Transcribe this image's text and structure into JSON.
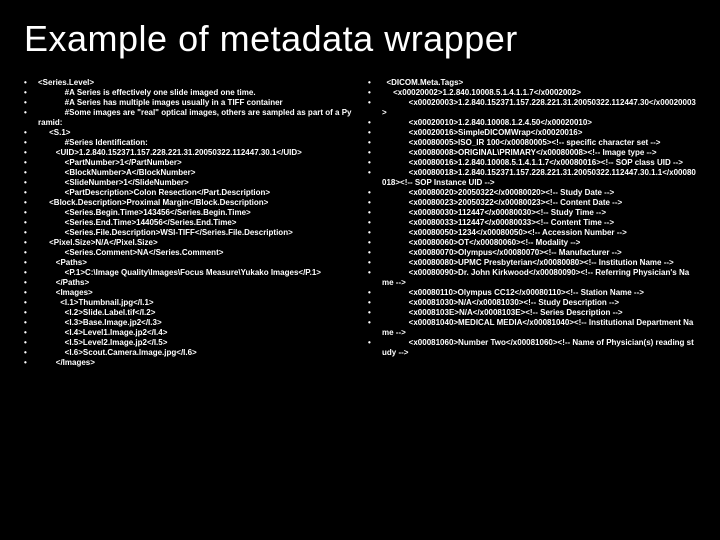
{
  "title": "Example of metadata wrapper",
  "left": [
    "<Series.Level>",
    "            #A Series is effectively one slide imaged one time.",
    "            #A Series has multiple images usually in a TIFF container",
    "            #Some images are \"real\" optical images, others are sampled as part of a Pyramid:",
    "     <S.1>",
    "            #Series Identification:",
    "        <UID>1.2.840.152371.157.228.221.31.20050322.112447.30.1</UID>",
    "            <PartNumber>1</PartNumber>",
    "            <BlockNumber>A</BlockNumber>",
    "            <SlideNumber>1</SlideNumber>",
    "            <PartDescription>Colon Resection</Part.Description>",
    "     <Block.Description>Proximal Margin</Block.Description>",
    "            <Series.Begin.Time>143456</Series.Begin.Time>",
    "            <Series.End.Time>144056</Series.End.Time>",
    "            <Series.File.Description>WSI-TIFF</Series.File.Description>",
    "     <Pixel.Size>N/A</Pixel.Size>",
    "            <Series.Comment>NA</Series.Comment>",
    "        <Paths>",
    "            <P.1>C:\\Image Quality\\Images\\Focus Measure\\Yukako Images</P.1>",
    "        </Paths>",
    "        <Images>",
    "          <I.1>Thumbnail.jpg</I.1>",
    "            <I.2>Slide.Label.tif</I.2>",
    "            <I.3>Base.Image.jp2</I.3>",
    "            <I.4>Level1.Image.jp2</I.4>",
    "            <I.5>Level2.Image.jp2</I.5>",
    "            <I.6>Scout.Camera.Image.jpg</I.6>",
    "        </Images>"
  ],
  "right": [
    "  <DICOM.Meta.Tags>",
    "     <x00020002>1.2.840.10008.5.1.4.1.1.7</x0002002>",
    "            <x00020003>1.2.840.152371.157.228.221.31.20050322.112447.30</x00020003>",
    "            <x00020010>1.2.840.10008.1.2.4.50</x00020010>",
    "            <x00020016>SimpleDICOMWrap</x00020016>",
    "            <x00080005>ISO_IR 100</x00080005><!-- specific character set -->",
    "            <x00080008>ORIGINAL\\PRIMARY</x00080008><!-- Image type -->",
    "            <x00080016>1.2.840.10008.5.1.4.1.1.7</x00080016><!-- SOP class UID -->",
    "            <x00080018>1.2.840.152371.157.228.221.31.20050322.112447.30.1.1</x00080018><!-- SOP Instance UID -->",
    "            <x00080020>20050322</x00080020><!-- Study Date -->",
    "            <x00080023>20050322</x00080023><!-- Content Date -->",
    "            <x00080030>112447</x00080030><!-- Study Time -->",
    "            <x00080033>112447</x00080033><!-- Content Time -->",
    "            <x00080050>1234</x00080050><!-- Accession Number -->",
    "            <x00080060>OT</x00080060><!-- Modality -->",
    "            <x00080070>Olympus</x00080070><!-- Manufacturer -->",
    "            <x00080080>UPMC Presbyterian</x00080080><!-- Institution Name -->",
    "            <x00080090>Dr. John Kirkwood</x00080090><!-- Referring Physician's Name -->",
    "            <x00080110>Olympus CC12</x00080110><!-- Station Name -->",
    "            <x00081030>N/A</x00081030><!-- Study Description -->",
    "            <x0008103E>N/A</x0008103E><!-- Series Description -->",
    "            <x00081040>MEDICAL MEDIA</x00081040><!-- Institutional Department Name -->",
    "            <x00081060>Number Two</x00081060><!-- Name of Physician(s) reading study -->"
  ]
}
